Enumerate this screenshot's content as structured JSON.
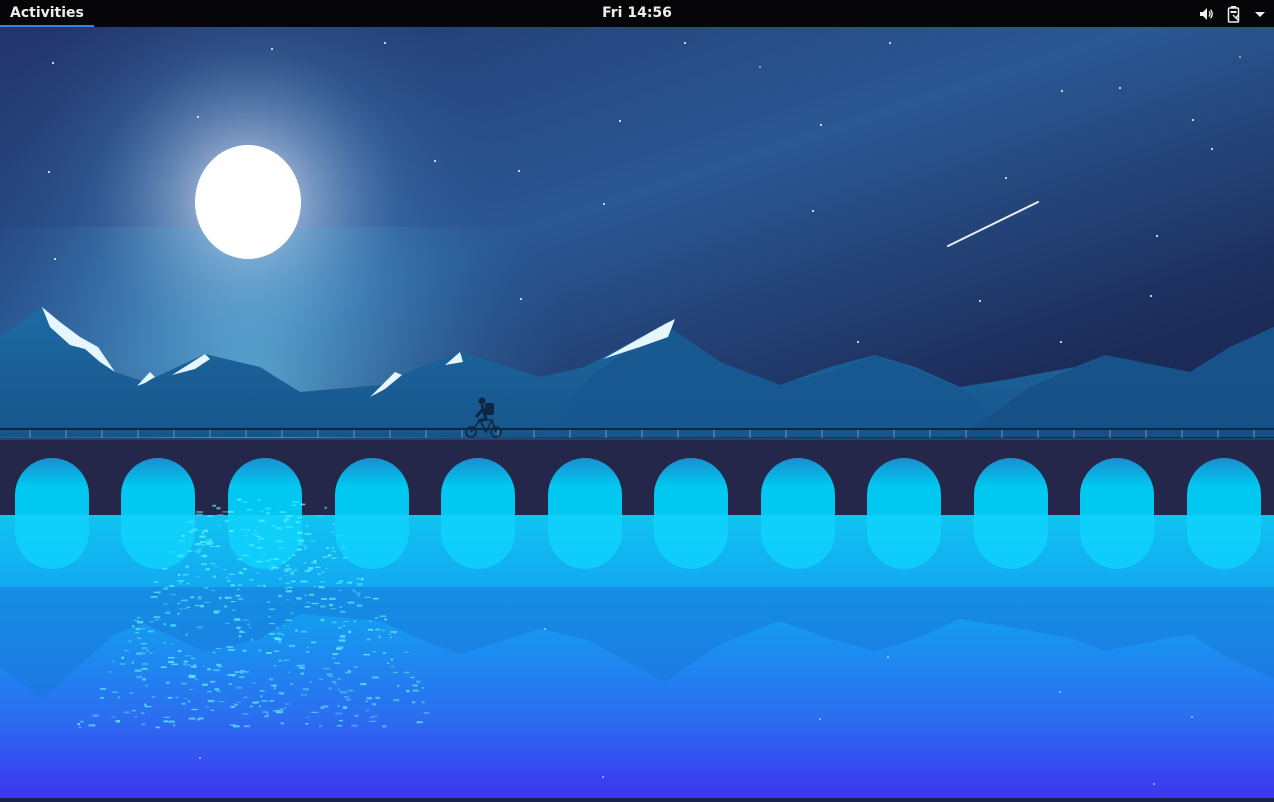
{
  "topbar": {
    "activities_label": "Activities",
    "clock": "Fri 14:56",
    "icons": [
      "volume-icon",
      "battery-icon",
      "menu-arrow-icon"
    ]
  },
  "desktop": {
    "wallpaper": "night-bridge-landscape",
    "colors": {
      "panel": "#060608",
      "sky_top": "#1c1f4e",
      "sky_mid": "#2f5f9e",
      "water": "#0fb8f0",
      "water_bottom": "#3a3ef2",
      "accent": "#3584e4"
    }
  }
}
